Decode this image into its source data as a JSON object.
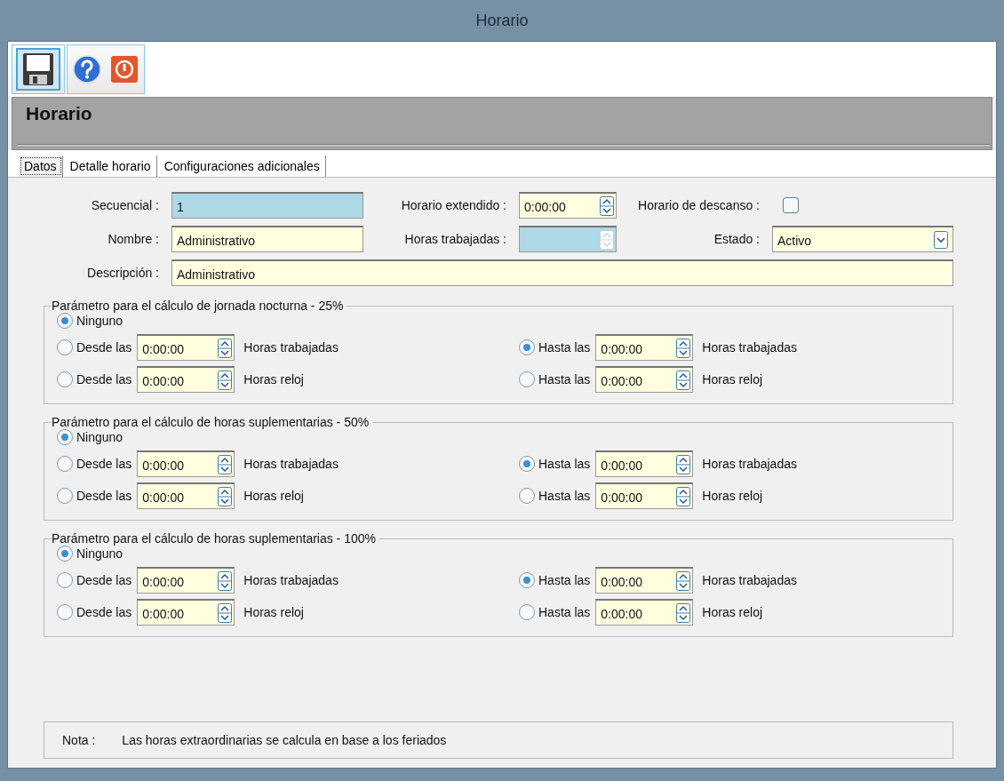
{
  "window": {
    "title": "Horario"
  },
  "toolbar": [
    {
      "kind": "save",
      "selected": true
    },
    {
      "kind": "help",
      "selected": false
    },
    {
      "kind": "power",
      "selected": false
    }
  ],
  "header": {
    "title": "Horario"
  },
  "tabs": [
    {
      "label": "Datos",
      "selected": true
    },
    {
      "label": "Detalle horario",
      "selected": false
    },
    {
      "label": "Configuraciones adicionales",
      "selected": false
    }
  ],
  "form": {
    "secuencial": {
      "label": "Secuencial :",
      "value": "1",
      "readonly": true
    },
    "horario_extendido": {
      "label": "Horario extendido :",
      "value": "0:00:00",
      "disabled": false
    },
    "horario_descanso": {
      "label": "Horario de descanso :",
      "checked": false
    },
    "nombre": {
      "label": "Nombre :",
      "value": "Administrativo",
      "readonly": false
    },
    "horas_trabajadas": {
      "label": "Horas trabajadas :",
      "disabled": true
    },
    "estado": {
      "label": "Estado :",
      "value": "Activo"
    },
    "descripcion": {
      "label": "Descripción :",
      "value": "Administrativo"
    }
  },
  "groups": [
    {
      "legend": "Parámetro para el cálculo de jornada nocturna - 25%",
      "none": {
        "label": "Ninguno",
        "selected": true
      },
      "rows": [
        {
          "cells": [
            {
              "label": "Desde las",
              "selected": false,
              "value": "0:00:00",
              "unit": "Horas trabajadas"
            },
            {
              "label": "Hasta las",
              "selected": true,
              "value": "0:00:00",
              "unit": "Horas trabajadas"
            }
          ]
        },
        {
          "cells": [
            {
              "label": "Desde las",
              "selected": false,
              "value": "0:00:00",
              "unit": "Horas reloj"
            },
            {
              "label": "Hasta las",
              "selected": false,
              "value": "0:00:00",
              "unit": "Horas reloj"
            }
          ]
        }
      ]
    },
    {
      "legend": "Parámetro para el cálculo de horas suplementarias - 50%",
      "none": {
        "label": "Ninguno",
        "selected": true
      },
      "rows": [
        {
          "cells": [
            {
              "label": "Desde las",
              "selected": false,
              "value": "0:00:00",
              "unit": "Horas trabajadas"
            },
            {
              "label": "Hasta las",
              "selected": true,
              "value": "0:00:00",
              "unit": "Horas trabajadas"
            }
          ]
        },
        {
          "cells": [
            {
              "label": "Desde las",
              "selected": false,
              "value": "0:00:00",
              "unit": "Horas reloj"
            },
            {
              "label": "Hasta las",
              "selected": false,
              "value": "0:00:00",
              "unit": "Horas reloj"
            }
          ]
        }
      ]
    },
    {
      "legend": "Parámetro para el cálculo de horas suplementarias - 100%",
      "none": {
        "label": "Ninguno",
        "selected": true
      },
      "rows": [
        {
          "cells": [
            {
              "label": "Desde las",
              "selected": false,
              "value": "0:00:00",
              "unit": "Horas trabajadas"
            },
            {
              "label": "Hasta las",
              "selected": true,
              "value": "0:00:00",
              "unit": "Horas trabajadas"
            }
          ]
        },
        {
          "cells": [
            {
              "label": "Desde las",
              "selected": false,
              "value": "0:00:00",
              "unit": "Horas reloj"
            },
            {
              "label": "Hasta las",
              "selected": false,
              "value": "0:00:00",
              "unit": "Horas reloj"
            }
          ]
        }
      ]
    }
  ],
  "note": {
    "label": "Nota :",
    "text": "Las horas extraordinarias se calcula en base a los feriados"
  }
}
